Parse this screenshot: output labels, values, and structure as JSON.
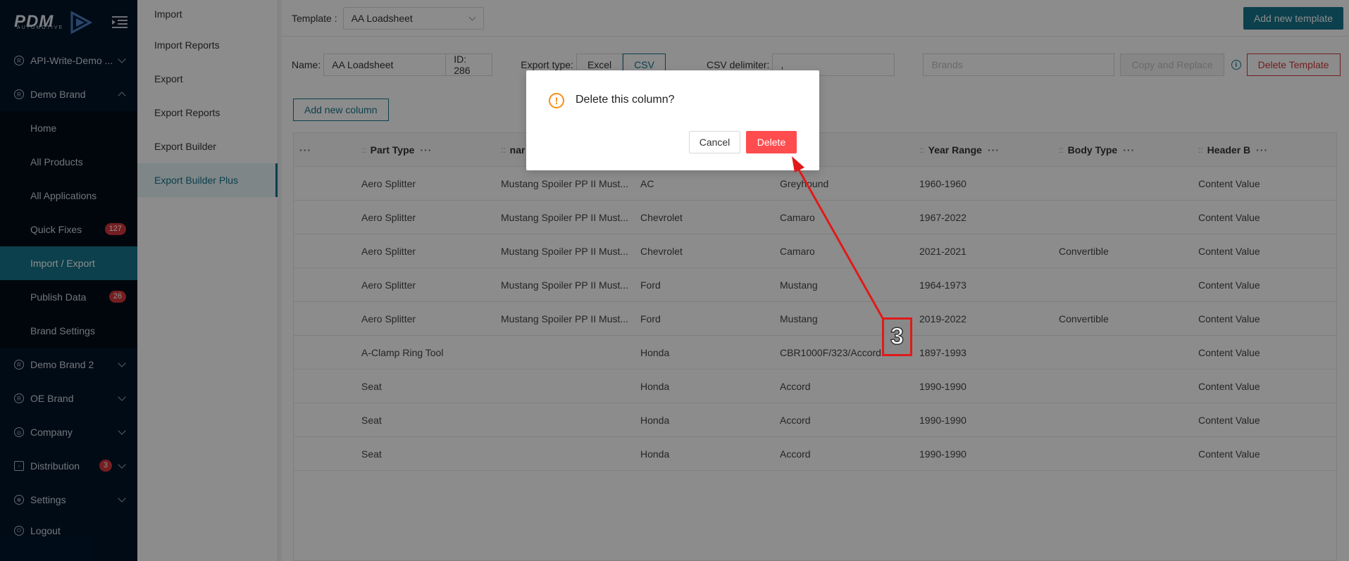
{
  "sidebar": {
    "logo": "PDM",
    "logo_sub": "AUTOMOTIVE",
    "items": [
      {
        "label": "API-Write-Demo ...",
        "icon": "registered-icon"
      },
      {
        "label": "Demo Brand",
        "icon": "registered-icon"
      },
      {
        "label": "Demo Brand 2",
        "icon": "registered-icon"
      },
      {
        "label": "OE Brand",
        "icon": "registered-icon"
      },
      {
        "label": "Company",
        "icon": "globe-icon"
      },
      {
        "label": "Distribution",
        "icon": "square-icon",
        "badge": "3"
      },
      {
        "label": "Settings",
        "icon": "gear-icon"
      },
      {
        "label": "Logout",
        "icon": "logout-icon"
      }
    ],
    "sub": [
      {
        "label": "Home"
      },
      {
        "label": "All Products"
      },
      {
        "label": "All Applications"
      },
      {
        "label": "Quick Fixes",
        "badge": "127"
      },
      {
        "label": "Import / Export"
      },
      {
        "label": "Publish Data",
        "badge": "26"
      },
      {
        "label": "Brand Settings"
      }
    ]
  },
  "submenu": [
    "Import",
    "Import Reports",
    "Export",
    "Export Reports",
    "Export Builder",
    "Export Builder Plus"
  ],
  "topbar": {
    "template_label": "Template :",
    "template_value": "AA Loadsheet",
    "add_template": "Add new template"
  },
  "form": {
    "name_label": "Name:",
    "name_value": "AA Loadsheet",
    "id_text": "ID: 286",
    "export_type_label": "Export type:",
    "export_types": [
      "Excel",
      "CSV"
    ],
    "csv_label": "CSV delimiter:",
    "csv_value": ",",
    "brands_placeholder": "Brands",
    "copy_replace": "Copy and Replace",
    "delete_template": "Delete Template",
    "add_column": "Add new column"
  },
  "table": {
    "columns": [
      "Part Type",
      "nar",
      "",
      "",
      "Year Range",
      "Body Type",
      "Header B"
    ],
    "rows": [
      [
        "Aero Splitter",
        "Mustang Spoiler PP II Must...",
        "AC",
        "Greyhound",
        "1960-1960",
        "",
        "Content Value"
      ],
      [
        "Aero Splitter",
        "Mustang Spoiler PP II Must...",
        "Chevrolet",
        "Camaro",
        "1967-2022",
        "",
        "Content Value"
      ],
      [
        "Aero Splitter",
        "Mustang Spoiler PP II Must...",
        "Chevrolet",
        "Camaro",
        "2021-2021",
        "Convertible",
        "Content Value"
      ],
      [
        "Aero Splitter",
        "Mustang Spoiler PP II Must...",
        "Ford",
        "Mustang",
        "1964-1973",
        "",
        "Content Value"
      ],
      [
        "Aero Splitter",
        "Mustang Spoiler PP II Must...",
        "Ford",
        "Mustang",
        "2019-2022",
        "Convertible",
        "Content Value"
      ],
      [
        "A-Clamp Ring Tool",
        "",
        "Honda",
        "CBR1000F/323/Accord",
        "1897-1993",
        "",
        "Content Value"
      ],
      [
        "Seat",
        "",
        "Honda",
        "Accord",
        "1990-1990",
        "",
        "Content Value"
      ],
      [
        "Seat",
        "",
        "Honda",
        "Accord",
        "1990-1990",
        "",
        "Content Value"
      ],
      [
        "Seat",
        "",
        "Honda",
        "Accord",
        "1990-1990",
        "",
        "Content Value"
      ]
    ]
  },
  "modal": {
    "title": "Delete this column?",
    "cancel": "Cancel",
    "delete": "Delete"
  },
  "annotation": {
    "step": "3",
    "color": "#e01a1a"
  }
}
